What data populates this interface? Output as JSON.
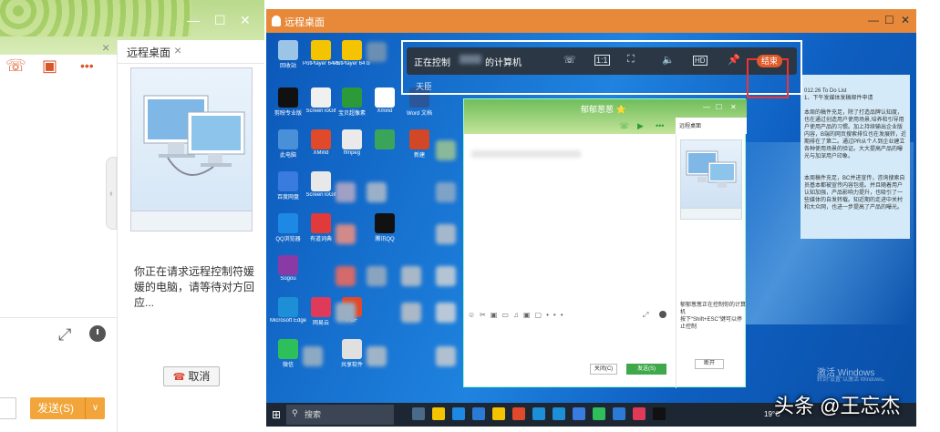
{
  "left": {
    "tab_label": "远程桌面",
    "tab_close": "×",
    "side_close": "×",
    "window_controls": [
      "—",
      "☐",
      "✕"
    ],
    "tool_icons": [
      "phone-icon",
      "video-icon",
      "more-icon"
    ],
    "more_label": "•••",
    "message": "你正在请求远程控制符媛媛的电脑，请等待对方回应...",
    "cancel_label": "取消",
    "send_label": "发送(S)",
    "send_arrow": "∨",
    "expand_icon": "⤢",
    "collapse_icon": "‹"
  },
  "remote": {
    "title": "远程桌面",
    "window_controls": [
      "—",
      "☐",
      "✕"
    ],
    "toolbar": {
      "text": "正在控制",
      "text2": "的计算机",
      "sub": "天臣",
      "buttons": [
        "☏",
        "1:1",
        "⛶",
        "🔈",
        "HD",
        "📌"
      ],
      "end_label": "结束"
    },
    "desktop_icons": [
      {
        "label": "回收站",
        "color": "#9bc4e6"
      },
      {
        "label": "PotPlayer 64 bit",
        "color": "#f5c400"
      },
      {
        "label": "PotPlayer 64 bit",
        "color": "#f5c400"
      },
      {
        "label": "剪映专业版",
        "color": "#111111"
      },
      {
        "label": "ScreenToGif",
        "color": "#f0f0f0"
      },
      {
        "label": "宝贝超像素",
        "color": "#2d9a3a"
      },
      {
        "label": "Xmind",
        "color": "#ffffff"
      },
      {
        "label": "Word 文档",
        "color": "#2b579a"
      },
      {
        "label": "此电脑",
        "color": "#4a90d9"
      },
      {
        "label": "XMind",
        "color": "#e04a2a"
      },
      {
        "label": "ffmpeg",
        "color": "#eaeaea"
      },
      {
        "label": "",
        "color": "#3aa55a"
      },
      {
        "label": "新建",
        "color": "#d24726"
      },
      {
        "label": "百度网盘",
        "color": "#3a7be0"
      },
      {
        "label": "ScreenToGif",
        "color": "#e8e8e8"
      },
      {
        "label": "QQ浏览器",
        "color": "#1e88e5"
      },
      {
        "label": "有道词典",
        "color": "#e03a3a"
      },
      {
        "label": "腾讯QQ",
        "color": "#111111"
      },
      {
        "label": "Sogou",
        "color": "#8a3aa5"
      },
      {
        "label": "Microsoft Edge",
        "color": "#1d8fd6"
      },
      {
        "label": "网易云",
        "color": "#e03a5a"
      },
      {
        "label": "PDF",
        "color": "#e04a2a"
      },
      {
        "label": "微信",
        "color": "#2dc05a"
      },
      {
        "label": "共享软件",
        "color": "#e0e0e0"
      }
    ],
    "inner_chat": {
      "name": "郁郁葱葱 ⭐",
      "tab": "远程桌面",
      "controls": [
        "—",
        "☐",
        "✕"
      ],
      "call_icons": [
        "☏",
        "▶",
        "•••"
      ],
      "info": "郁郁葱葱正在控制你的计算机",
      "hint": "按下“Shift+ESC”键可以停止控制",
      "stop_label": "断开",
      "close_label": "关闭(C)",
      "send_label": "发送(S)",
      "tools": "☺✂▣▭♫▣▢•••"
    },
    "note": {
      "line1": "012.26 To Do List",
      "line2": "1、下午发媒体发稿邮件申请",
      "para1": "本周的稿件充足，除了打造品牌认知度，也在通过创造用户使用场景,培养和引导用户使用产品的习惯。加上持续输出企业版内容，B端的网页搜索排位也在发展转，近期排在了第二。通过PR从个人到企业建立各种使用场景的验证。大大提高产品的曝光与加深用户印象。",
      "para2": "本周稿件充足，BC并进宣传，咨询搜索自员基本都被宣传内容包揽。并且随着用户认知加强，产品影响力提升，也吸引了一些媒体的自发转载。知近期的走进中关村和大众网，也进一步提高了产品的曝光。"
    },
    "activation": "激活 Windows",
    "activation_sub": "转到“设置”以激活 Windows。",
    "taskbar": {
      "start": "⊞",
      "search_icon": "⚲",
      "search": "搜索",
      "temp": "19°C",
      "apps": [
        "#4a6a8a",
        "#f5c400",
        "#1e88e5",
        "#2b7bd6",
        "#f5c400",
        "#e04a2a",
        "#1d8fd6",
        "#1d8fd6",
        "#3a7be0",
        "#2dc05a",
        "#2b7bd6",
        "#e03a5a",
        "#111111"
      ]
    }
  },
  "watermark": "头条 @王忘杰"
}
